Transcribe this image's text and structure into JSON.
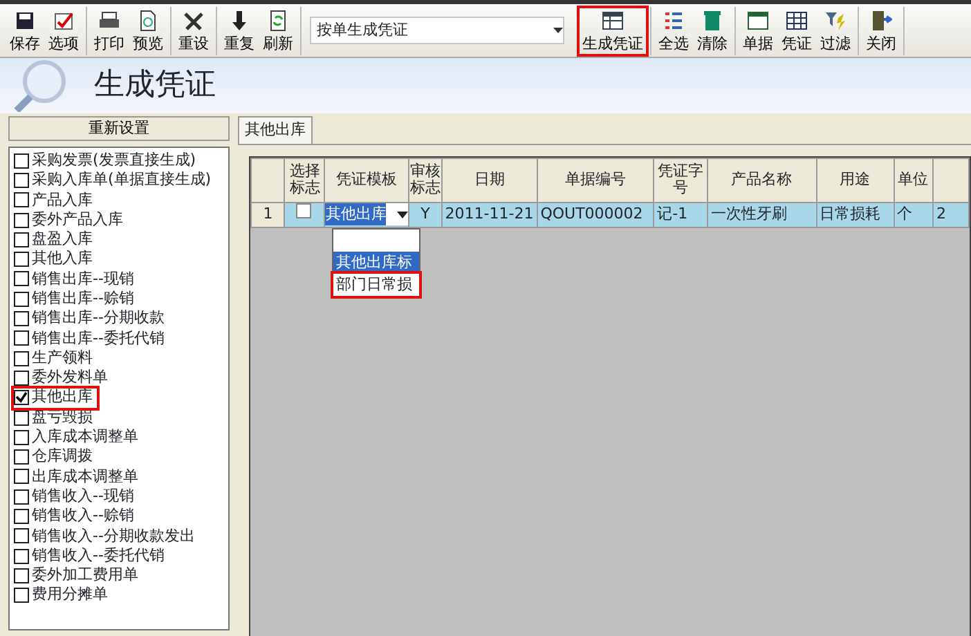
{
  "toolbar": {
    "groups": [
      [
        {
          "label": "保存",
          "highlighted": false
        },
        {
          "label": "选项",
          "highlighted": false
        }
      ],
      [
        {
          "label": "打印",
          "highlighted": false
        },
        {
          "label": "预览",
          "highlighted": false
        }
      ],
      [
        {
          "label": "重设",
          "highlighted": false
        }
      ],
      [
        {
          "label": "重复",
          "highlighted": false
        },
        {
          "label": "刷新",
          "highlighted": false
        }
      ],
      [
        {
          "kind": "combo",
          "value": "按单生成凭证"
        }
      ],
      [
        {
          "label": "生成凭证",
          "highlighted": true
        }
      ],
      [
        {
          "label": "全选",
          "highlighted": false
        },
        {
          "label": "清除",
          "highlighted": false
        }
      ],
      [
        {
          "label": "单据",
          "highlighted": false
        },
        {
          "label": "凭证",
          "highlighted": false
        },
        {
          "label": "过滤",
          "highlighted": false
        }
      ],
      [
        {
          "label": "关闭",
          "highlighted": false
        }
      ]
    ]
  },
  "header": {
    "title": "生成凭证"
  },
  "left_panel": {
    "reset_button": "重新设置",
    "items": [
      {
        "label": "采购发票(发票直接生成)",
        "checked": false,
        "highlighted": false
      },
      {
        "label": "采购入库单(单据直接生成)",
        "checked": false,
        "highlighted": false
      },
      {
        "label": "产品入库",
        "checked": false,
        "highlighted": false
      },
      {
        "label": "委外产品入库",
        "checked": false,
        "highlighted": false
      },
      {
        "label": "盘盈入库",
        "checked": false,
        "highlighted": false
      },
      {
        "label": "其他入库",
        "checked": false,
        "highlighted": false
      },
      {
        "label": "销售出库--现销",
        "checked": false,
        "highlighted": false
      },
      {
        "label": "销售出库--赊销",
        "checked": false,
        "highlighted": false
      },
      {
        "label": "销售出库--分期收款",
        "checked": false,
        "highlighted": false
      },
      {
        "label": "销售出库--委托代销",
        "checked": false,
        "highlighted": false
      },
      {
        "label": "生产领料",
        "checked": false,
        "highlighted": false
      },
      {
        "label": "委外发料单",
        "checked": false,
        "highlighted": false
      },
      {
        "label": "其他出库",
        "checked": true,
        "highlighted": true
      },
      {
        "label": "盘亏毁损",
        "checked": false,
        "highlighted": false
      },
      {
        "label": "入库成本调整单",
        "checked": false,
        "highlighted": false
      },
      {
        "label": "仓库调拨",
        "checked": false,
        "highlighted": false
      },
      {
        "label": "出库成本调整单",
        "checked": false,
        "highlighted": false
      },
      {
        "label": "销售收入--现销",
        "checked": false,
        "highlighted": false
      },
      {
        "label": "销售收入--赊销",
        "checked": false,
        "highlighted": false
      },
      {
        "label": "销售收入--分期收款发出",
        "checked": false,
        "highlighted": false
      },
      {
        "label": "销售收入--委托代销",
        "checked": false,
        "highlighted": false
      },
      {
        "label": "委外加工费用单",
        "checked": false,
        "highlighted": false
      },
      {
        "label": "费用分摊单",
        "checked": false,
        "highlighted": false
      }
    ]
  },
  "tabs": [
    {
      "label": "其他出库",
      "selected": true
    }
  ],
  "table": {
    "columns": [
      "",
      "选择标志",
      "凭证模板",
      "审核标志",
      "日期",
      "单据编号",
      "凭证字号",
      "产品名称",
      "用途",
      "单位",
      ""
    ],
    "rows": [
      {
        "selected": true,
        "checked": false,
        "cells": [
          "1",
          "",
          "其他出库",
          "Y",
          "2011-11-21",
          "QOUT000002",
          "记-1",
          "一次性牙刷",
          "日常损耗",
          "个",
          "2"
        ]
      }
    ]
  },
  "template_dropdown": {
    "options": [
      {
        "label": "其他出库标",
        "selected": true,
        "highlighted": false
      },
      {
        "label": "部门日常损",
        "selected": false,
        "highlighted": true
      }
    ]
  }
}
